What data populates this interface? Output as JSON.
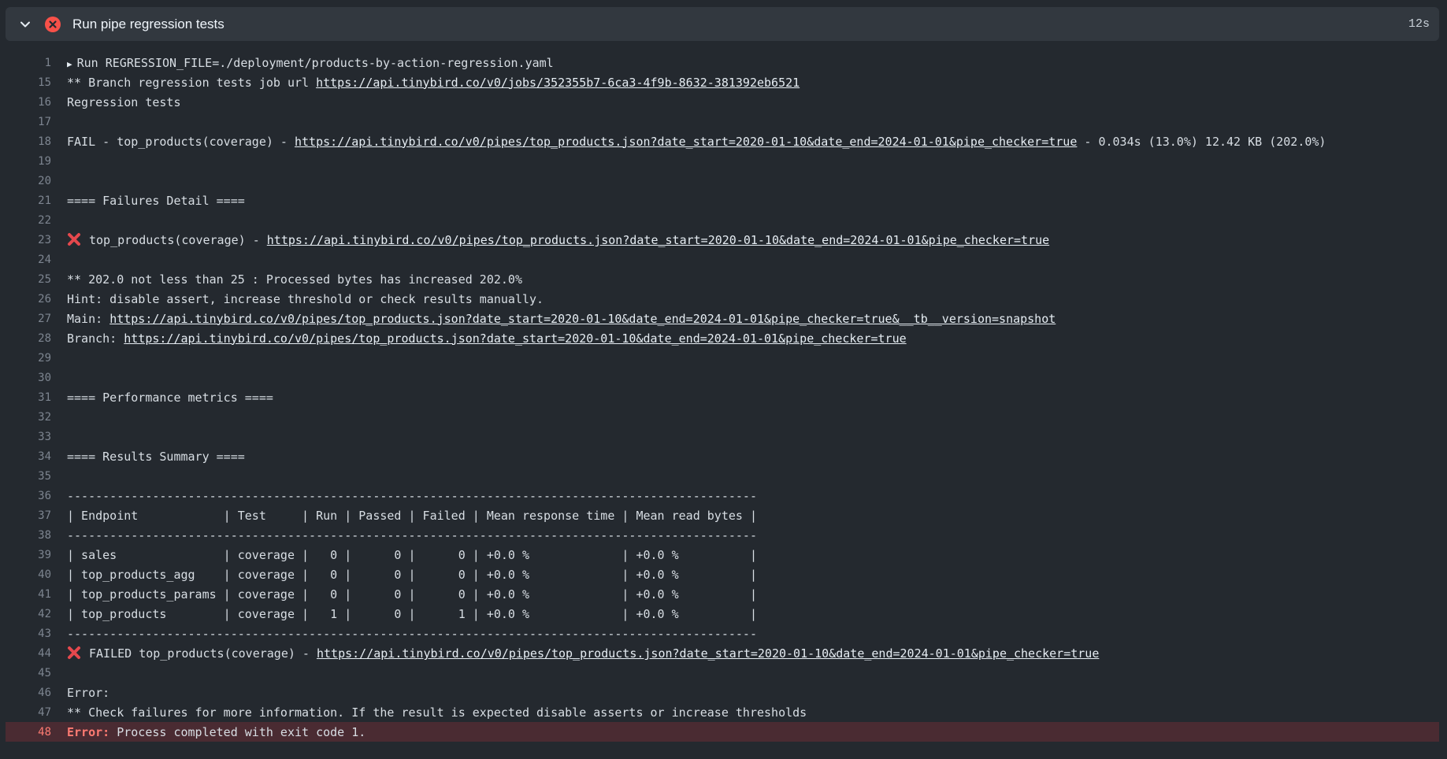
{
  "step": {
    "title": "Run pipe regression tests",
    "duration": "12s",
    "status_icon": "error-circle-icon",
    "status_color": "#f85149"
  },
  "lines": [
    {
      "n": "1",
      "collapsed": true,
      "text": "Run REGRESSION_FILE=./deployment/products-by-action-regression.yaml"
    },
    {
      "n": "15",
      "prefix": "** Branch regression tests job url ",
      "link": "https://api.tinybird.co/v0/jobs/352355b7-6ca3-4f9b-8632-381392eb6521"
    },
    {
      "n": "16",
      "text": "Regression tests"
    },
    {
      "n": "17",
      "text": ""
    },
    {
      "n": "18",
      "prefix": "FAIL - top_products(coverage) - ",
      "link": "https://api.tinybird.co/v0/pipes/top_products.json?date_start=2020-01-10&date_end=2024-01-01&pipe_checker=true",
      "suffix": " - 0.034s (13.0%) 12.42 KB (202.0%)"
    },
    {
      "n": "19",
      "text": ""
    },
    {
      "n": "20",
      "text": ""
    },
    {
      "n": "21",
      "text": "==== Failures Detail ===="
    },
    {
      "n": "22",
      "text": ""
    },
    {
      "n": "23",
      "x_icon": true,
      "prefix": "top_products(coverage) - ",
      "link": "https://api.tinybird.co/v0/pipes/top_products.json?date_start=2020-01-10&date_end=2024-01-01&pipe_checker=true"
    },
    {
      "n": "24",
      "text": ""
    },
    {
      "n": "25",
      "text": "** 202.0 not less than 25 : Processed bytes has increased 202.0%"
    },
    {
      "n": "26",
      "text": "Hint: disable assert, increase threshold or check results manually."
    },
    {
      "n": "27",
      "prefix": "Main: ",
      "link": "https://api.tinybird.co/v0/pipes/top_products.json?date_start=2020-01-10&date_end=2024-01-01&pipe_checker=true&__tb__version=snapshot"
    },
    {
      "n": "28",
      "prefix": "Branch: ",
      "link": "https://api.tinybird.co/v0/pipes/top_products.json?date_start=2020-01-10&date_end=2024-01-01&pipe_checker=true"
    },
    {
      "n": "29",
      "text": ""
    },
    {
      "n": "30",
      "text": ""
    },
    {
      "n": "31",
      "text": "==== Performance metrics ===="
    },
    {
      "n": "32",
      "text": ""
    },
    {
      "n": "33",
      "text": ""
    },
    {
      "n": "34",
      "text": "==== Results Summary ===="
    },
    {
      "n": "35",
      "text": ""
    },
    {
      "n": "36",
      "text": "-------------------------------------------------------------------------------------------------"
    },
    {
      "n": "37",
      "text": "| Endpoint            | Test     | Run | Passed | Failed | Mean response time | Mean read bytes |"
    },
    {
      "n": "38",
      "text": "-------------------------------------------------------------------------------------------------"
    },
    {
      "n": "39",
      "text": "| sales               | coverage |   0 |      0 |      0 | +0.0 %             | +0.0 %          |"
    },
    {
      "n": "40",
      "text": "| top_products_agg    | coverage |   0 |      0 |      0 | +0.0 %             | +0.0 %          |"
    },
    {
      "n": "41",
      "text": "| top_products_params | coverage |   0 |      0 |      0 | +0.0 %             | +0.0 %          |"
    },
    {
      "n": "42",
      "text": "| top_products        | coverage |   1 |      0 |      1 | +0.0 %             | +0.0 %          |"
    },
    {
      "n": "43",
      "text": "-------------------------------------------------------------------------------------------------"
    },
    {
      "n": "44",
      "x_icon": true,
      "prefix": "FAILED top_products(coverage) - ",
      "link": "https://api.tinybird.co/v0/pipes/top_products.json?date_start=2020-01-10&date_end=2024-01-01&pipe_checker=true"
    },
    {
      "n": "45",
      "text": ""
    },
    {
      "n": "46",
      "text": "Error:"
    },
    {
      "n": "47",
      "text": "** Check failures for more information. If the result is expected disable asserts or increase thresholds"
    },
    {
      "n": "48",
      "error": true,
      "error_label": "Error:",
      "text": " Process completed with exit code 1."
    }
  ]
}
